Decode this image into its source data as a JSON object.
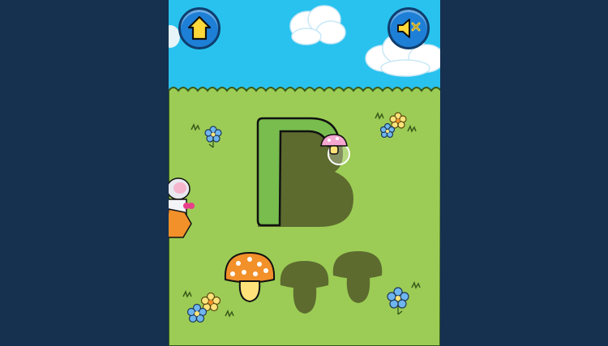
{
  "colors": {
    "page_bg": "#16304f",
    "sky": "#29c2ee",
    "grass": "#9ccc55",
    "letter_fill": "#78bd4e",
    "letter_shadow": "#5d6b2f",
    "mushroom_orange": "#f2902a",
    "button_blue": "#1e7fd6"
  },
  "game": {
    "target_letter": "B",
    "letter_trace_progress": 0.1
  },
  "buttons": {
    "home_icon": "home-icon",
    "sound_icon": "sound-muted-icon"
  },
  "collectibles": {
    "total": 3,
    "found": 1
  }
}
